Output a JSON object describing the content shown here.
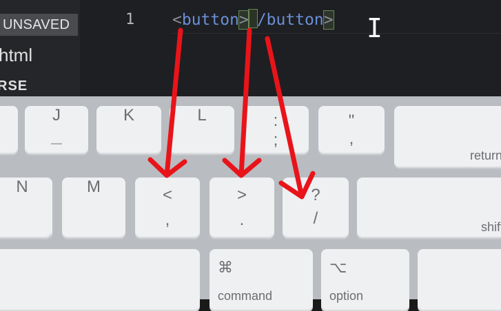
{
  "sidebar": {
    "unsaved_label": "UNSAVED",
    "file_label": "html",
    "section_label": "RSE"
  },
  "editor": {
    "line_number": "1",
    "code_open_tag": "<button>",
    "code_close_tag": "/button>"
  },
  "keyboard": {
    "keys": {
      "j": "J",
      "k": "K",
      "l": "L",
      "semicolon_top": ":",
      "semicolon_bottom": ";",
      "quote_top": "\"",
      "quote_bottom": ",",
      "return": "return",
      "n": "N",
      "m": "M",
      "comma_top": "<",
      "comma_bottom": ",",
      "period_top": ">",
      "period_bottom": ".",
      "slash_top": "?",
      "slash_bottom": "/",
      "shift": "shift",
      "command_symbol": "⌘",
      "command": "command",
      "option_symbol": "⌥",
      "option": "option"
    }
  },
  "colors": {
    "arrow": "#e8141a",
    "tag_text": "#6a8fd6",
    "editor_bg": "#1e1f22"
  }
}
